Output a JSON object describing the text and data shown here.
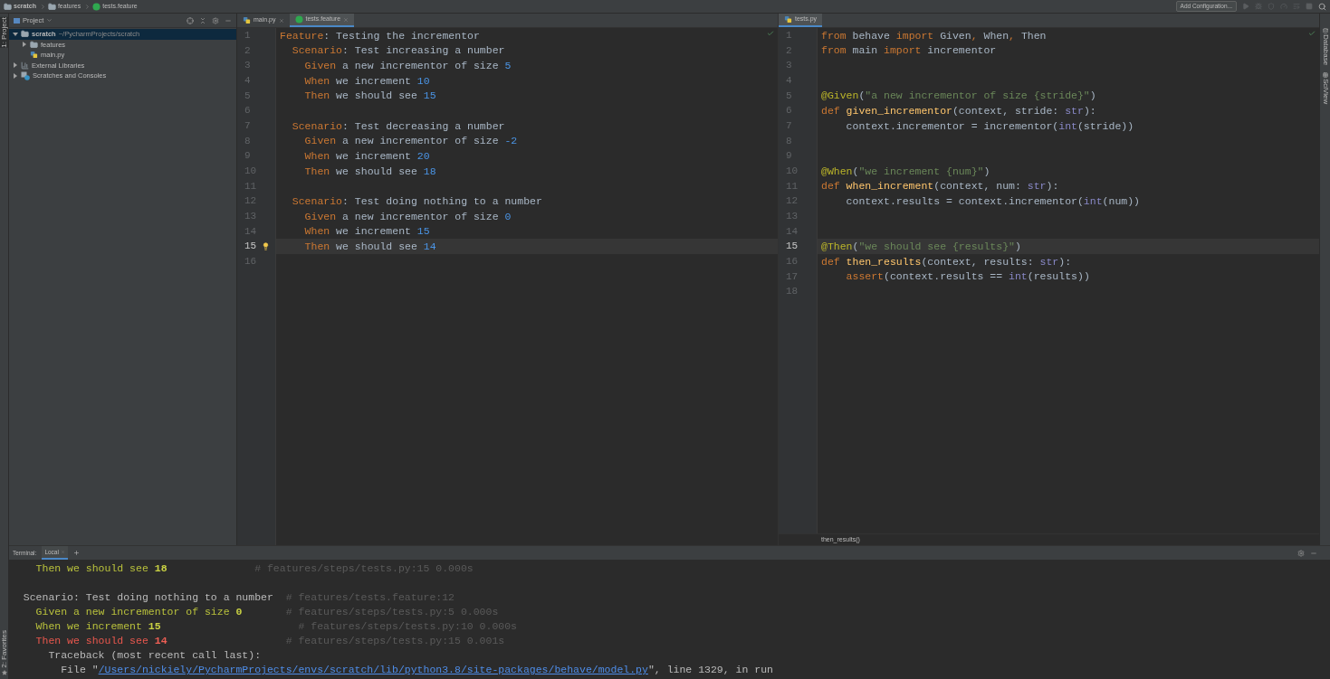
{
  "breadcrumbs": [
    {
      "label": "scratch",
      "kind": "folder"
    },
    {
      "label": "features",
      "kind": "folder"
    },
    {
      "label": "tests.feature",
      "kind": "feature"
    }
  ],
  "toolbar": {
    "config_button": "Add Configuration..."
  },
  "left_strip": {
    "top": "1: Project",
    "bottom": "2: Favorites"
  },
  "right_strip": [
    "Database",
    "SciView"
  ],
  "project": {
    "title": "Project",
    "tree": [
      {
        "label": "scratch",
        "path": "~/PycharmProjects/scratch",
        "kind": "folder",
        "expanded": true,
        "selected": true,
        "children": [
          {
            "label": "features",
            "kind": "folder",
            "expanded": false,
            "selected": false
          },
          {
            "label": "main.py",
            "kind": "python",
            "selected": false
          }
        ]
      },
      {
        "label": "External Libraries",
        "kind": "library",
        "expanded": false,
        "selected": false
      },
      {
        "label": "Scratches and Consoles",
        "kind": "scratches",
        "expanded": false,
        "selected": false
      }
    ]
  },
  "editors": [
    {
      "tabs": [
        {
          "label": "main.py",
          "kind": "python",
          "selected": false,
          "closable": true
        },
        {
          "label": "tests.feature",
          "kind": "feature",
          "selected": true,
          "closable": true
        }
      ],
      "lines": [
        {
          "number": "1",
          "current": false,
          "bulb": false,
          "tokens": [
            {
              "text": "Feature",
              "kind": "kw"
            },
            {
              "text": ": Testing the incrementor",
              "kind": "plain"
            }
          ]
        },
        {
          "number": "2",
          "current": false,
          "bulb": false,
          "tokens": [
            {
              "text": "  Scenario",
              "kind": "kw"
            },
            {
              "text": ": Test increasing a number",
              "kind": "plain"
            }
          ]
        },
        {
          "number": "3",
          "current": false,
          "bulb": false,
          "tokens": [
            {
              "text": "    Given",
              "kind": "kw"
            },
            {
              "text": " a new incrementor of size ",
              "kind": "plain"
            },
            {
              "text": "5",
              "kind": "num"
            }
          ]
        },
        {
          "number": "4",
          "current": false,
          "bulb": false,
          "tokens": [
            {
              "text": "    When",
              "kind": "kw"
            },
            {
              "text": " we increment ",
              "kind": "plain"
            },
            {
              "text": "10",
              "kind": "num"
            }
          ]
        },
        {
          "number": "5",
          "current": false,
          "bulb": false,
          "tokens": [
            {
              "text": "    Then",
              "kind": "kw"
            },
            {
              "text": " we should see ",
              "kind": "plain"
            },
            {
              "text": "15",
              "kind": "num"
            }
          ]
        },
        {
          "number": "6",
          "current": false,
          "bulb": false
        },
        {
          "number": "7",
          "current": false,
          "bulb": false,
          "tokens": [
            {
              "text": "  Scenario",
              "kind": "kw"
            },
            {
              "text": ": Test decreasing a number",
              "kind": "plain"
            }
          ]
        },
        {
          "number": "8",
          "current": false,
          "bulb": false,
          "tokens": [
            {
              "text": "    Given",
              "kind": "kw"
            },
            {
              "text": " a new incrementor of size ",
              "kind": "plain"
            },
            {
              "text": "-2",
              "kind": "num"
            }
          ]
        },
        {
          "number": "9",
          "current": false,
          "bulb": false,
          "tokens": [
            {
              "text": "    When",
              "kind": "kw"
            },
            {
              "text": " we increment ",
              "kind": "plain"
            },
            {
              "text": "20",
              "kind": "num"
            }
          ]
        },
        {
          "number": "10",
          "current": false,
          "bulb": false,
          "tokens": [
            {
              "text": "    Then",
              "kind": "kw"
            },
            {
              "text": " we should see ",
              "kind": "plain"
            },
            {
              "text": "18",
              "kind": "num"
            }
          ]
        },
        {
          "number": "11",
          "current": false,
          "bulb": false
        },
        {
          "number": "12",
          "current": false,
          "bulb": false,
          "tokens": [
            {
              "text": "  Scenario",
              "kind": "kw"
            },
            {
              "text": ": Test doing nothing to a number",
              "kind": "plain"
            }
          ]
        },
        {
          "number": "13",
          "current": false,
          "bulb": false,
          "tokens": [
            {
              "text": "    Given",
              "kind": "kw"
            },
            {
              "text": " a new incrementor of size ",
              "kind": "plain"
            },
            {
              "text": "0",
              "kind": "num"
            }
          ]
        },
        {
          "number": "14",
          "current": false,
          "bulb": false,
          "tokens": [
            {
              "text": "    When",
              "kind": "kw"
            },
            {
              "text": " we increment ",
              "kind": "plain"
            },
            {
              "text": "15",
              "kind": "num"
            }
          ]
        },
        {
          "number": "15",
          "current": true,
          "bulb": true,
          "tokens": [
            {
              "text": "    Then",
              "kind": "kw"
            },
            {
              "text": " we should see ",
              "kind": "plain"
            },
            {
              "text": "14",
              "kind": "num"
            }
          ]
        },
        {
          "number": "16",
          "current": false,
          "bulb": false
        }
      ]
    },
    {
      "tabs": [
        {
          "label": "tests.py",
          "kind": "python",
          "selected": true,
          "closable": false
        }
      ],
      "breadcrumb": "then_results()",
      "lines": [
        {
          "number": "1",
          "current": false,
          "tokens": [
            {
              "text": "from",
              "kind": "kw"
            },
            {
              "text": " behave ",
              "kind": "plain"
            },
            {
              "text": "import",
              "kind": "kw"
            },
            {
              "text": " Given",
              "kind": "plain"
            },
            {
              "text": ",",
              "kind": "kw"
            },
            {
              "text": " When",
              "kind": "plain"
            },
            {
              "text": ",",
              "kind": "kw"
            },
            {
              "text": " Then",
              "kind": "plain"
            }
          ]
        },
        {
          "number": "2",
          "current": false,
          "tokens": [
            {
              "text": "from",
              "kind": "kw"
            },
            {
              "text": " main ",
              "kind": "plain"
            },
            {
              "text": "import",
              "kind": "kw"
            },
            {
              "text": " incrementor",
              "kind": "plain"
            }
          ]
        },
        {
          "number": "3",
          "current": false
        },
        {
          "number": "4",
          "current": false
        },
        {
          "number": "5",
          "current": false,
          "tokens": [
            {
              "text": "@Given",
              "kind": "deco"
            },
            {
              "text": "(",
              "kind": "plain"
            },
            {
              "text": "\"a new incrementor of size {stride}\"",
              "kind": "str"
            },
            {
              "text": ")",
              "kind": "plain"
            }
          ]
        },
        {
          "number": "6",
          "current": false,
          "tokens": [
            {
              "text": "def ",
              "kind": "kw"
            },
            {
              "text": "given_incrementor",
              "kind": "func"
            },
            {
              "text": "(context, stride: ",
              "kind": "plain"
            },
            {
              "text": "str",
              "kind": "builtin"
            },
            {
              "text": "):",
              "kind": "plain"
            }
          ]
        },
        {
          "number": "7",
          "current": false,
          "tokens": [
            {
              "text": "    context.incrementor = incrementor(",
              "kind": "plain"
            },
            {
              "text": "int",
              "kind": "builtin"
            },
            {
              "text": "(stride))",
              "kind": "plain"
            }
          ]
        },
        {
          "number": "8",
          "current": false
        },
        {
          "number": "9",
          "current": false
        },
        {
          "number": "10",
          "current": false,
          "tokens": [
            {
              "text": "@When",
              "kind": "deco"
            },
            {
              "text": "(",
              "kind": "plain"
            },
            {
              "text": "\"we increment {num}\"",
              "kind": "str"
            },
            {
              "text": ")",
              "kind": "plain"
            }
          ]
        },
        {
          "number": "11",
          "current": false,
          "tokens": [
            {
              "text": "def ",
              "kind": "kw"
            },
            {
              "text": "when_increment",
              "kind": "func"
            },
            {
              "text": "(context, num: ",
              "kind": "plain"
            },
            {
              "text": "str",
              "kind": "builtin"
            },
            {
              "text": "):",
              "kind": "plain"
            }
          ]
        },
        {
          "number": "12",
          "current": false,
          "tokens": [
            {
              "text": "    context.results = context.incrementor(",
              "kind": "plain"
            },
            {
              "text": "int",
              "kind": "builtin"
            },
            {
              "text": "(num))",
              "kind": "plain"
            }
          ]
        },
        {
          "number": "13",
          "current": false
        },
        {
          "number": "14",
          "current": false
        },
        {
          "number": "15",
          "current": true,
          "tokens": [
            {
              "text": "@Then",
              "kind": "deco"
            },
            {
              "text": "(",
              "kind": "plain"
            },
            {
              "text": "\"we should see {results}\"",
              "kind": "str"
            },
            {
              "text": ")",
              "kind": "plain"
            }
          ]
        },
        {
          "number": "16",
          "current": false,
          "tokens": [
            {
              "text": "def ",
              "kind": "kw"
            },
            {
              "text": "then_results",
              "kind": "func"
            },
            {
              "text": "(context, results: ",
              "kind": "plain"
            },
            {
              "text": "str",
              "kind": "builtin"
            },
            {
              "text": "):",
              "kind": "plain"
            }
          ]
        },
        {
          "number": "17",
          "current": false,
          "tokens": [
            {
              "text": "    assert",
              "kind": "kw"
            },
            {
              "text": "(context.results == ",
              "kind": "plain"
            },
            {
              "text": "int",
              "kind": "builtin"
            },
            {
              "text": "(results))",
              "kind": "plain"
            }
          ]
        },
        {
          "number": "18",
          "current": false
        }
      ]
    }
  ],
  "terminal": {
    "title": "Terminal:",
    "tabs": [
      {
        "label": "Local",
        "selected": true
      }
    ],
    "blocks": [
      {
        "lines": [
          {
            "tokens": [
              {
                "text": "    Then we should see ",
                "kind": "passed"
              },
              {
                "text": "18",
                "kind": "passed_arg"
              },
              {
                "text": "              # features/steps/tests.py:15 0.000s",
                "kind": "comment"
              }
            ]
          }
        ]
      },
      {
        "lines": [
          {
            "tokens": [
              {
                "text": "  Scenario: Test doing nothing to a number",
                "kind": "plain"
              },
              {
                "text": "  # features/tests.feature:12",
                "kind": "comment"
              }
            ]
          },
          {
            "tokens": [
              {
                "text": "    Given a new incrementor of size ",
                "kind": "passed"
              },
              {
                "text": "0",
                "kind": "passed_arg"
              },
              {
                "text": "       # features/steps/tests.py:5 0.000s",
                "kind": "comment"
              }
            ]
          },
          {
            "tokens": [
              {
                "text": "    When we increment ",
                "kind": "passed"
              },
              {
                "text": "15",
                "kind": "passed_arg"
              },
              {
                "text": "                      # features/steps/tests.py:10 0.000s",
                "kind": "comment"
              }
            ]
          },
          {
            "tokens": [
              {
                "text": "    Then we should see ",
                "kind": "failed"
              },
              {
                "text": "14",
                "kind": "failed_arg"
              },
              {
                "text": "                   # features/steps/tests.py:15 0.001s",
                "kind": "comment"
              }
            ]
          },
          {
            "tokens": [
              {
                "text": "      Traceback (most recent call last):",
                "kind": "plain"
              }
            ]
          },
          {
            "tokens": [
              {
                "text": "        File \"",
                "kind": "plain"
              },
              {
                "text": "/Users/nickiely/PycharmProjects/envs/scratch/lib/python3.8/site-packages/behave/model.py",
                "kind": "link"
              },
              {
                "text": "\", line 1329, in run",
                "kind": "plain"
              }
            ]
          }
        ]
      }
    ]
  }
}
